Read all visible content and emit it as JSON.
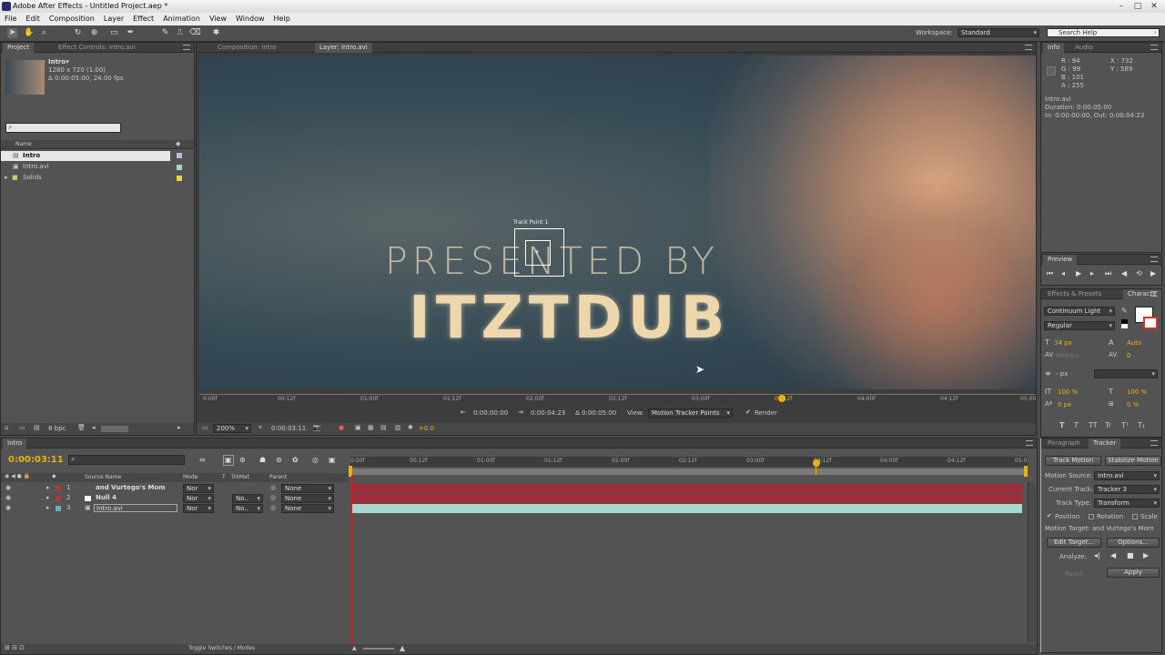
{
  "window": {
    "title": "Adobe After Effects - Untitled Project.aep *"
  },
  "menu": [
    "File",
    "Edit",
    "Composition",
    "Layer",
    "Effect",
    "Animation",
    "View",
    "Window",
    "Help"
  ],
  "toolbar": {
    "workspace_label": "Workspace:",
    "workspace_value": "Standard",
    "search_placeholder": "Search Help"
  },
  "project": {
    "tabs": [
      "Project",
      "Effect Controls: Intro.avi"
    ],
    "item_name": "Intro▾",
    "item_info1": "1280 x 720 (1.00)",
    "item_info2": "Δ 0:00:05:00, 24.00 fps",
    "col_name": "Name",
    "items": [
      {
        "name": "Intro",
        "icon": "composition-icon"
      },
      {
        "name": "Intro.avi",
        "icon": "footage-icon"
      },
      {
        "name": "Solids",
        "icon": "folder-icon"
      }
    ],
    "bpc": "8 bpc"
  },
  "viewer": {
    "tabs": [
      "Composition: Intro",
      "Layer: Intro.avi"
    ],
    "text_line1": "PRESENTED BY",
    "text_line2": "ITZTDUB",
    "track_point_label": "Track Point 1",
    "ruler_ticks": [
      "0:00f",
      "00:12f",
      "01:00f",
      "01:12f",
      "02:00f",
      "02:12f",
      "03:00f",
      "03:12f",
      "04:00f",
      "04:12f",
      "05:00"
    ],
    "current_marker": "03:12f",
    "in_time": "0:00:00:00",
    "out_time": "0:00:04:23",
    "duration": "Δ 0:00:05:00",
    "view_label": "View:",
    "view_value": "Motion Tracker Points",
    "render_label": "Render",
    "zoom": "200%",
    "current_time_small": "0:00:03:11",
    "exposure": "+0.0"
  },
  "info": {
    "tabs": [
      "Info",
      "Audio"
    ],
    "r": "R : 94",
    "g": "G : 99",
    "b": "B : 101",
    "a": "A : 255",
    "x": "X : 732",
    "y": "Y : 589",
    "name": "Intro.avi",
    "duration": "Duration: 0:00:05:00",
    "inout": "In: 0:00:00:00, Out: 0:00:04:23"
  },
  "preview": {
    "tab": "Preview"
  },
  "character": {
    "tabs": [
      "Effects & Presets",
      "Characte"
    ],
    "font": "Continuum Light",
    "style": "Regular",
    "size": "34 px",
    "leading": "Auto",
    "kerning": "Metrics",
    "tracking": "0",
    "stroke_unit": "- px",
    "vscale": "100 %",
    "hscale": "100 %",
    "baseline": "0 px",
    "tsume": "0 %",
    "text_styles": [
      "T",
      "T",
      "TT",
      "Tr",
      "T¹",
      "T₁"
    ]
  },
  "tracker": {
    "tabs": [
      "Paragraph",
      "Tracker"
    ],
    "track_motion": "Track Motion",
    "stabilize_motion": "Stabilize Motion",
    "motion_source_label": "Motion Source:",
    "motion_source": "Intro.avi",
    "current_track_label": "Current Track:",
    "current_track": "Tracker 3",
    "track_type_label": "Track Type:",
    "track_type": "Transform",
    "position": "Position",
    "rotation": "Rotation",
    "scale": "Scale",
    "motion_target_label": "Motion Target:",
    "motion_target": "and Vurtego's Mom",
    "edit_target": "Edit Target...",
    "options": "Options...",
    "analyze_label": "Analyze:",
    "reset": "Reset",
    "apply": "Apply"
  },
  "timeline": {
    "tab": "Intro",
    "current_time": "0:00:03:11",
    "col_source": "Source Name",
    "col_mode": "Mode",
    "col_t": "T",
    "col_trkmat": "TrkMat",
    "col_parent": "Parent",
    "layers": [
      {
        "num": "1",
        "name": "and Vurtego's Mom",
        "mode": "Nor",
        "trkmat": "",
        "parent": "None",
        "color": "#b03a3a",
        "bar": "#9e2f3a"
      },
      {
        "num": "2",
        "name": "Null 4",
        "mode": "Nor",
        "trkmat": "No..",
        "parent": "None",
        "color": "#b03a3a",
        "bar": "#9e2f3a"
      },
      {
        "num": "3",
        "name": "Intro.avi",
        "mode": "Nor",
        "trkmat": "No..",
        "parent": "None",
        "color": "#5fb4a8",
        "bar": "#a9d6cd"
      }
    ],
    "ruler_ticks": [
      "0:00f",
      "00:12f",
      "01:00f",
      "01:12f",
      "02:00f",
      "02:12f",
      "03:00f",
      "03:12f",
      "04:00f",
      "04:12f",
      "05:0"
    ],
    "toggle_label": "Toggle Switches / Modes"
  },
  "colors": {
    "accent": "#e8b400",
    "bg": "#535353",
    "dark": "#3e3e3e"
  }
}
